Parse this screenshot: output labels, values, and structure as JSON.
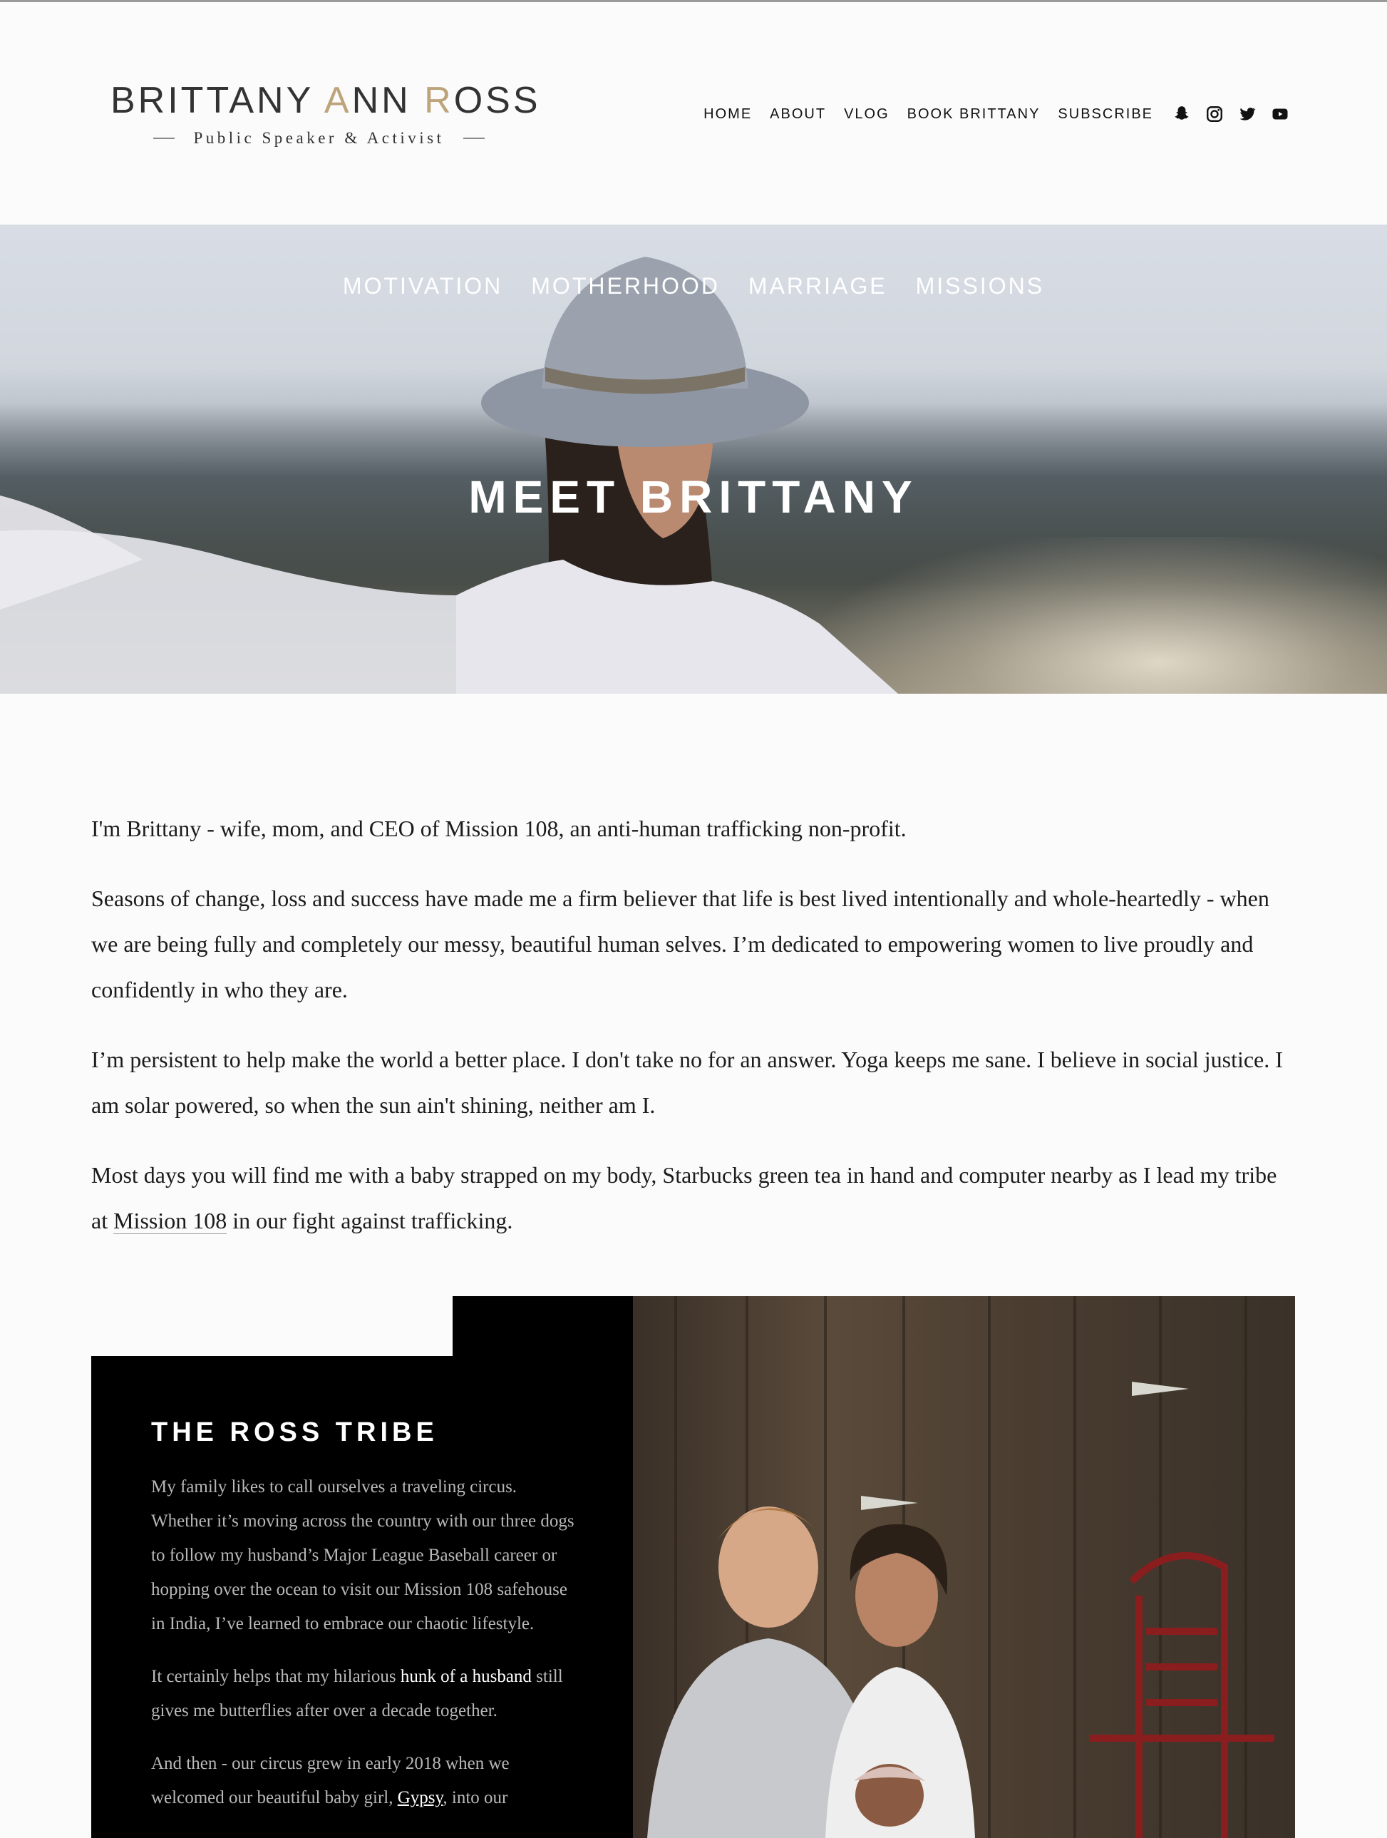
{
  "header": {
    "logo": {
      "name_part1": "BRITTANY ",
      "name_accent1": "A",
      "name_part2": "NN ",
      "name_accent2": "R",
      "name_part3": "OSS",
      "tagline": "Public Speaker & Activist"
    },
    "nav": [
      "HOME",
      "ABOUT",
      "VLOG",
      "BOOK BRITTANY",
      "SUBSCRIBE"
    ],
    "social_icons": [
      "snapchat-icon",
      "instagram-icon",
      "twitter-icon",
      "youtube-icon"
    ]
  },
  "hero": {
    "tabs": [
      "MOTIVATION",
      "MOTHERHOOD",
      "MARRIAGE",
      "MISSIONS"
    ],
    "title": "MEET BRITTANY"
  },
  "about": {
    "p1": "I'm Brittany - wife, mom, and CEO of Mission 108, an anti-human trafficking non-profit.",
    "p2": "Seasons of change, loss and success have made me a firm believer that life is best lived intentionally and whole-heartedly - when we are being fully and completely our messy, beautiful human selves. I’m dedicated to empowering women to live proudly and confidently in who they are.",
    "p3": "I’m persistent to help make the world a better place. I don't take no for an answer. Yoga keeps me sane. I believe in social justice. I am solar powered, so when the sun ain't shining, neither am I.",
    "p4_before": "Most days you will find me with a baby strapped on my body, Starbucks green tea in hand and computer nearby as I lead my tribe at ",
    "p4_link": "Mission 108",
    "p4_after": " in our fight against trafficking."
  },
  "tribe": {
    "title": "THE ROSS TRIBE",
    "p1": "My family likes to call ourselves a traveling circus. Whether it’s moving across the country with our three dogs to follow my husband’s Major League Baseball career or hopping over the ocean to visit our Mission 108 safehouse in India, I’ve learned to embrace our chaotic lifestyle.",
    "p2_before": "It certainly helps that my hilarious ",
    "p2_link": "hunk of a husband",
    "p2_after": " still gives me butterflies after over a decade together.",
    "p3_before": "And then - our circus grew in early 2018 when we welcomed our beautiful baby girl, ",
    "p3_link": "Gypsy",
    "p3_after": ", into our"
  },
  "colors": {
    "accent_gold": "#bda47a",
    "text": "#1c1c1c",
    "tribe_bg": "#000000"
  }
}
